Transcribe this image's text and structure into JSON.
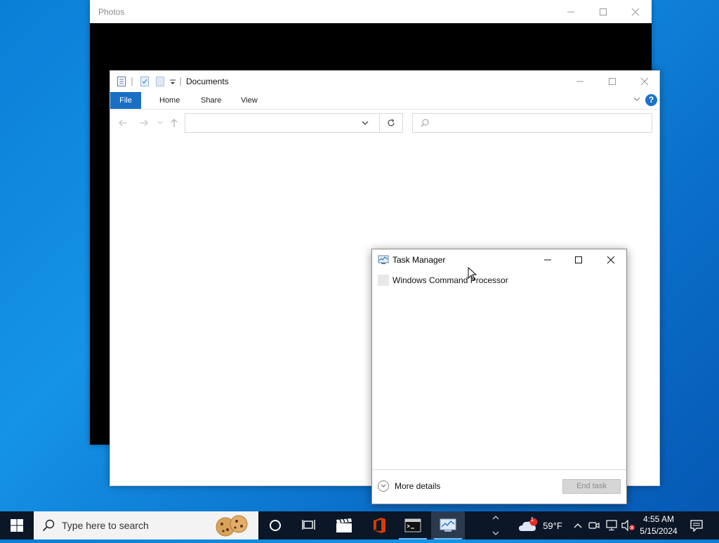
{
  "photos": {
    "title": "Photos"
  },
  "explorer": {
    "title": "Documents",
    "ribbon_tabs": [
      "File",
      "Home",
      "Share",
      "View"
    ],
    "help": "?"
  },
  "task_manager": {
    "title": "Task Manager",
    "process": "Windows Command Processor",
    "more_details": "More details",
    "end_task": "End task"
  },
  "taskbar": {
    "search_placeholder": "Type here to search",
    "weather_temp": "59°F",
    "weather_badge": "1",
    "time": "4:55 AM",
    "date": "5/15/2024"
  },
  "colors": {
    "desktop": "#0a7fd6",
    "file_tab": "#1a6fc4",
    "taskbar": "#0b1626",
    "office": "#d83b01"
  }
}
